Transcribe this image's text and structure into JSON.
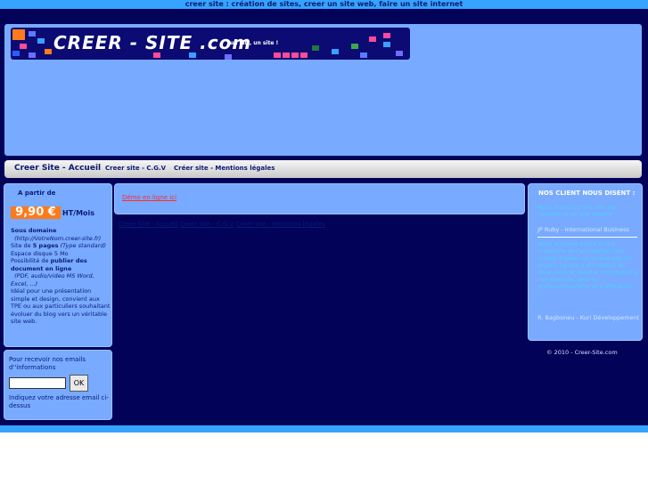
{
  "page": {
    "top_tagline": "creer site :  création de sites, creer un site web, faire un site internet"
  },
  "logo": {
    "main": "CREER   - SITE .com",
    "sub": "un clic, un site !"
  },
  "nav": {
    "title": "Creer Site - Accueil",
    "cgv": "Creer site - C.G.V",
    "mentions": "Créer site - Mentions légales"
  },
  "offer": {
    "a_partir": "A partir de",
    "price": "9,90 €",
    "unit": "HT/Mois",
    "sous_domaine_label": "Sous domaine",
    "sous_domaine_example": "(http://VotreNom.creer-site.fr)",
    "site_de": "Site de ",
    "pages": "5 pages",
    "pages_type": "(Type standard)",
    "disk": "Espace disque 5 Mo",
    "possibilite": "Possibilité de ",
    "publier": "publier des document en ligne",
    "formats": "(PDF, audio/video MS Word, Excel, ...)",
    "ideal": "Idéal pour une présentation simple et design, convient aux TPE ou aux particuliers souhaitant évoluer du blog vers un véritable site web."
  },
  "newsletter": {
    "intro": "Pour recevoir nos emails d''informations",
    "input_value": "",
    "ok_label": "OK",
    "note": "Indiquez votre adresse email ci-dessus"
  },
  "content": {
    "demo_link": "Démo en ligne ici",
    "link_home": "Creer Site - Accueil",
    "link_cgv": "Creer site - C.G.V",
    "link_mentions": "Créer site - Mentions légales"
  },
  "testimonials": {
    "title": "NOS CLIENT NOUS DISENT :",
    "quote1": "Nous avons eu très vite nos conseils et un site adapté",
    "author1": "JP Ruby - International Business",
    "quote2": "Nous sommes partis d'une maquette de l'entreprise, très simple à gérer, je ne suis pas un expert. Le site a été réalisé en deux mois le résultat correspond à nos attentes, plus du professionnalisme et d'efficacité.",
    "author2": "R. Bagboneu - Kuri Développement"
  },
  "footer": {
    "copyright": "© 2010 - Creer-Site.com"
  },
  "colors": {
    "background": "#030259",
    "panel": "#78aaff",
    "accent_orange": "#ff7a1a",
    "strip": "#35a3ff"
  }
}
